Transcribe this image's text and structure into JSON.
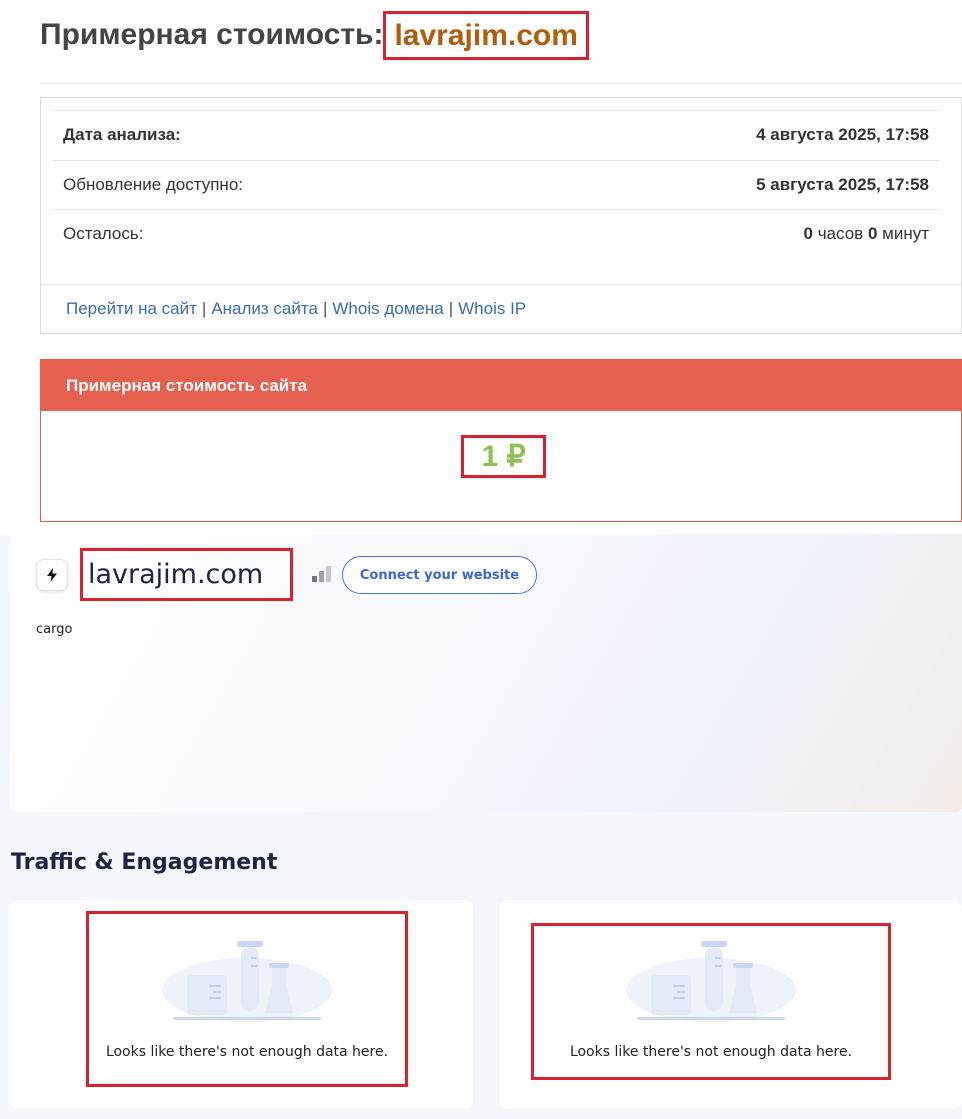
{
  "header": {
    "title_prefix": "Примерная стоимость:",
    "domain": "lavrajim.com"
  },
  "analysis": {
    "rows": [
      {
        "label": "Дата анализа:",
        "value": "4 августа 2025, 17:58"
      },
      {
        "label": "Обновление доступно:",
        "value": "5 августа 2025, 17:58"
      }
    ],
    "remaining": {
      "label": "Осталось:",
      "hours": "0",
      "hours_unit": "часов",
      "minutes": "0",
      "minutes_unit": "минут"
    },
    "links": [
      "Перейти на сайт",
      "Анализ сайта",
      "Whois домена",
      "Whois IP"
    ],
    "separator": "|"
  },
  "cost": {
    "header": "Примерная стоимость сайта",
    "value": "1 ₽"
  },
  "site": {
    "name": "lavrajim.com",
    "connect_button": "Connect your website",
    "category": "cargo"
  },
  "traffic": {
    "heading": "Traffic & Engagement",
    "cards": [
      {
        "empty_message": "Looks like there's not enough data here."
      },
      {
        "empty_message": "Looks like there's not enough data here."
      }
    ]
  },
  "colors": {
    "domain_title": "#b25d0c",
    "highlight_border": "#d9212f",
    "cost_header_bg": "#e5604f",
    "cost_value": "#8dc152",
    "link": "#3a6ea5",
    "connect_button": "#3d66cf"
  },
  "icons": [
    "bolt-icon",
    "rank-bars-icon",
    "lab-flasks-illustration"
  ]
}
